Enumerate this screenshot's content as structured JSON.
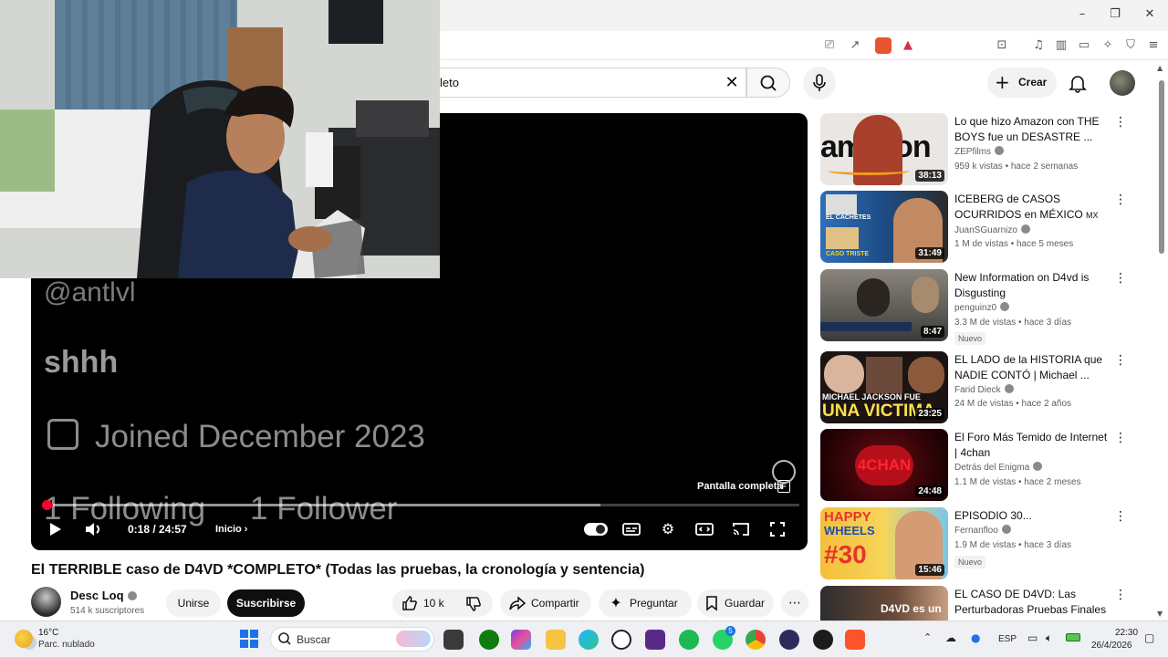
{
  "header": {
    "search_value": "leto",
    "create_label": "Crear"
  },
  "player": {
    "screen_texts": {
      "handle": "@antlvl",
      "shhh": "shhh",
      "joined": "Joined December 2023",
      "following": "1 Following",
      "follower": "1 Follower"
    },
    "time": "0:18 / 24:57",
    "chapter": "Inicio",
    "fullscreen_tooltip": "Pantalla completa",
    "fullscreen_key": "F",
    "progress_fraction": 0.012,
    "accent_color": "#ff0033"
  },
  "video": {
    "title": "El TERRIBLE caso de D4VD *COMPLETO* (Todas las pruebas, la cronología y sentencia)",
    "channel_name": "Desc Loq",
    "channel_subs": "514 k suscriptores",
    "join_label": "Unirse",
    "subscribe_label": "Suscribirse",
    "likes": "10 k",
    "share_label": "Compartir",
    "ask_label": "Preguntar",
    "save_label": "Guardar"
  },
  "recommendations": [
    {
      "title": "Lo que hizo Amazon con THE BOYS fue un DESASTRE ...",
      "channel": "ZEPfilms",
      "meta": "959 k vistas • hace 2 semanas",
      "duration": "38:13",
      "badge": ""
    },
    {
      "title": "ICEBERG de CASOS OCURRIDOS en MÉXICO",
      "title_suffix": "MX",
      "channel": "JuanSGuarnizo",
      "meta": "1 M de vistas • hace 5 meses",
      "duration": "31:49",
      "badge": ""
    },
    {
      "title": "New Information on D4vd is Disgusting",
      "channel": "penguinz0",
      "meta": "3.3 M de vistas • hace 3 días",
      "duration": "8:47",
      "badge": "Nuevo"
    },
    {
      "title": "EL LADO de la HISTORIA que NADIE CONTÓ | Michael ...",
      "channel": "Farid Dieck",
      "meta": "24 M de vistas • hace 2 años",
      "duration": "23:25",
      "badge": ""
    },
    {
      "title": "El Foro Más Temido de Internet | 4chan",
      "channel": "Detrás del Enigma",
      "meta": "1.1 M de vistas • hace 2 meses",
      "duration": "24:48",
      "badge": ""
    },
    {
      "title": "EPISODIO 30...",
      "channel": "Fernanfloo",
      "meta": "1.9 M de vistas • hace 3 días",
      "duration": "15:46",
      "badge": "Nuevo"
    },
    {
      "title": "EL CASO DE D4VD: Las Perturbadoras Pruebas Finales",
      "channel": "",
      "meta": "",
      "duration": "",
      "badge": ""
    }
  ],
  "thumb_texts": {
    "amazon": "amazon",
    "cachetes": "EL CACHETES",
    "caso_triste": "CASO TRISTE",
    "mj1": "MICHAEL JACKSON FUE",
    "mj2": "UNA VICTIMA",
    "fourchan": "4CHAN",
    "happy": "HAPPY",
    "wheels": "WHEELS",
    "num30": "#30",
    "d4vd": "D4VD es un"
  },
  "taskbar": {
    "weather_temp": "16°C",
    "weather_desc": "Parc. nublado",
    "search_placeholder": "Buscar",
    "language": "ESP",
    "time": "22:30",
    "date": "26/4/2026",
    "badge_whatsapp": "5"
  },
  "colors": {
    "brand_red": "#ff0033",
    "dark": "#0f0f0f"
  }
}
